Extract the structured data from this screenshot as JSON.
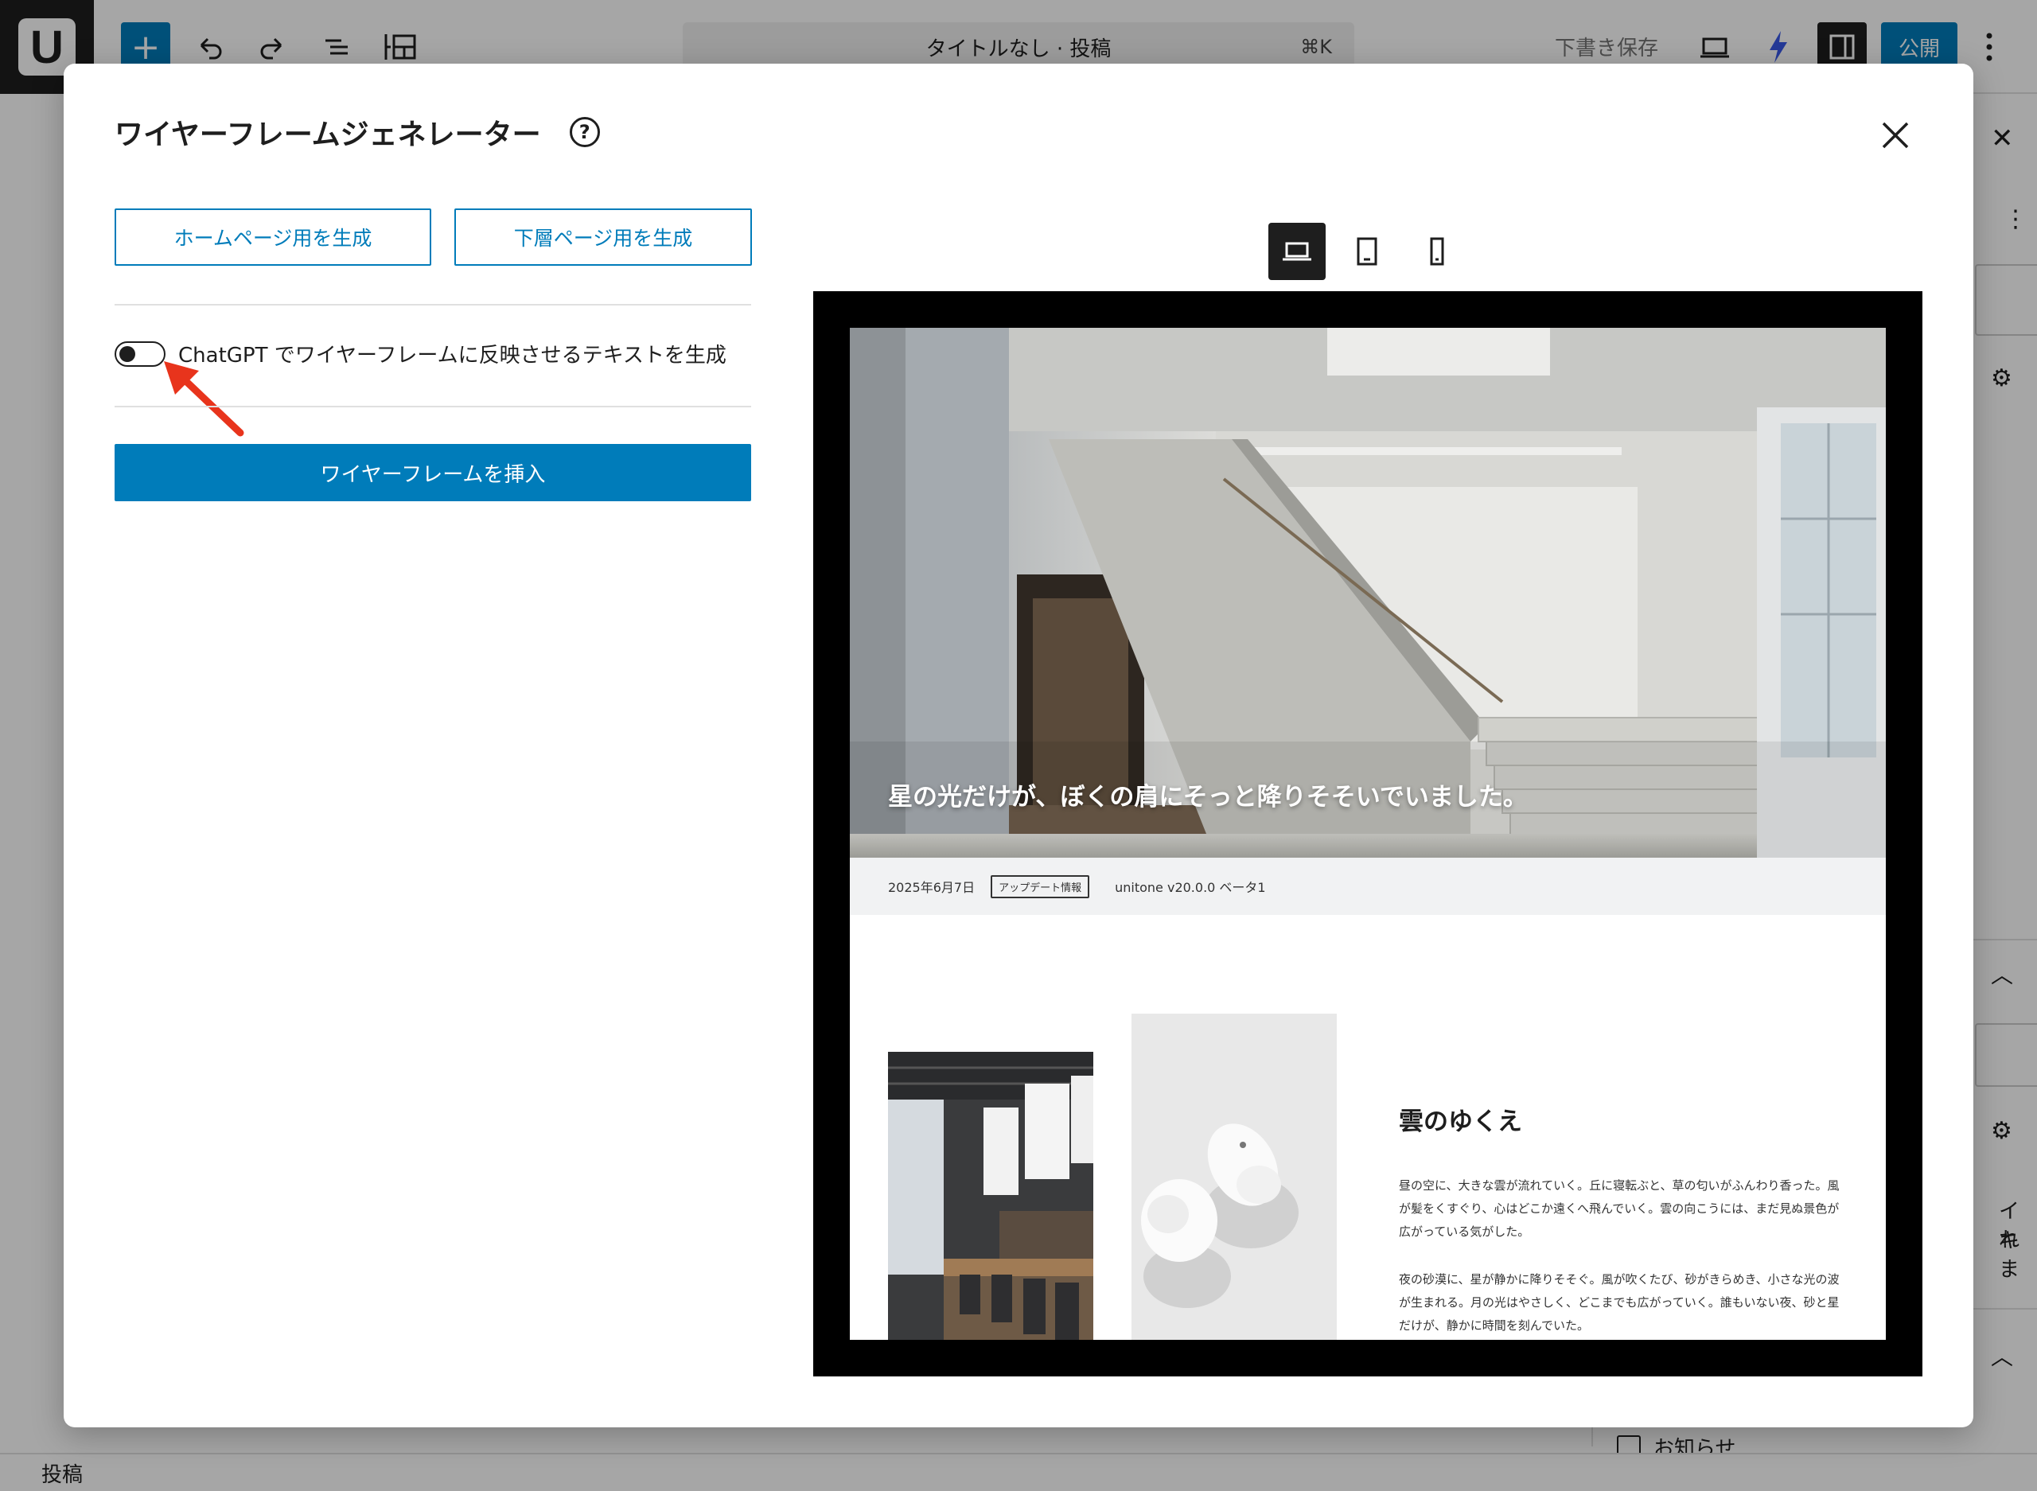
{
  "editor": {
    "logo_letter": "U",
    "doc_title": "タイトルなし · 投稿",
    "shortcut": "⌘K",
    "save_draft": "下書き保存",
    "publish": "公開",
    "footer_label": "投稿",
    "sidebar_fragment_1": "イキ",
    "sidebar_fragment_2": "れま",
    "news_checkbox_label": "お知らせ"
  },
  "modal": {
    "title": "ワイヤーフレームジェネレーター",
    "help_glyph": "?",
    "buttons": {
      "home": "ホームページ用を生成",
      "lower": "下層ページ用を生成",
      "insert": "ワイヤーフレームを挿入"
    },
    "toggle": {
      "label": "ChatGPT でワイヤーフレームに反映させるテキストを生成",
      "checked": false
    },
    "device_options": [
      "desktop-icon",
      "tablet-icon",
      "mobile-icon"
    ],
    "active_device": "desktop"
  },
  "preview": {
    "hero_text": "星の光だけが、ぼくの肩にそっと降りそそいでいました。",
    "news": {
      "date": "2025年6月7日",
      "tag": "アップデート情報",
      "title": "unitone v20.0.0 ベータ1"
    },
    "article": {
      "heading": "雲のゆくえ",
      "para1": "昼の空に、大きな雲が流れていく。丘に寝転ぶと、草の匂いがふんわり香った。風が髪をくすぐり、心はどこか遠くへ飛んでいく。雲の向こうには、まだ見ぬ景色が広がっている気がした。",
      "para2": "夜の砂漠に、星が静かに降りそそぐ。風が吹くたび、砂がきらめき、小さな光の波が生まれる。月の光はやさしく、どこまでも広がっていく。誰もいない夜、砂と星だけが、静かに時間を刻んでいた。"
    }
  },
  "colors": {
    "accent": "#007cba",
    "dark": "#1e1e1e",
    "annotation_arrow": "#e8341c"
  }
}
